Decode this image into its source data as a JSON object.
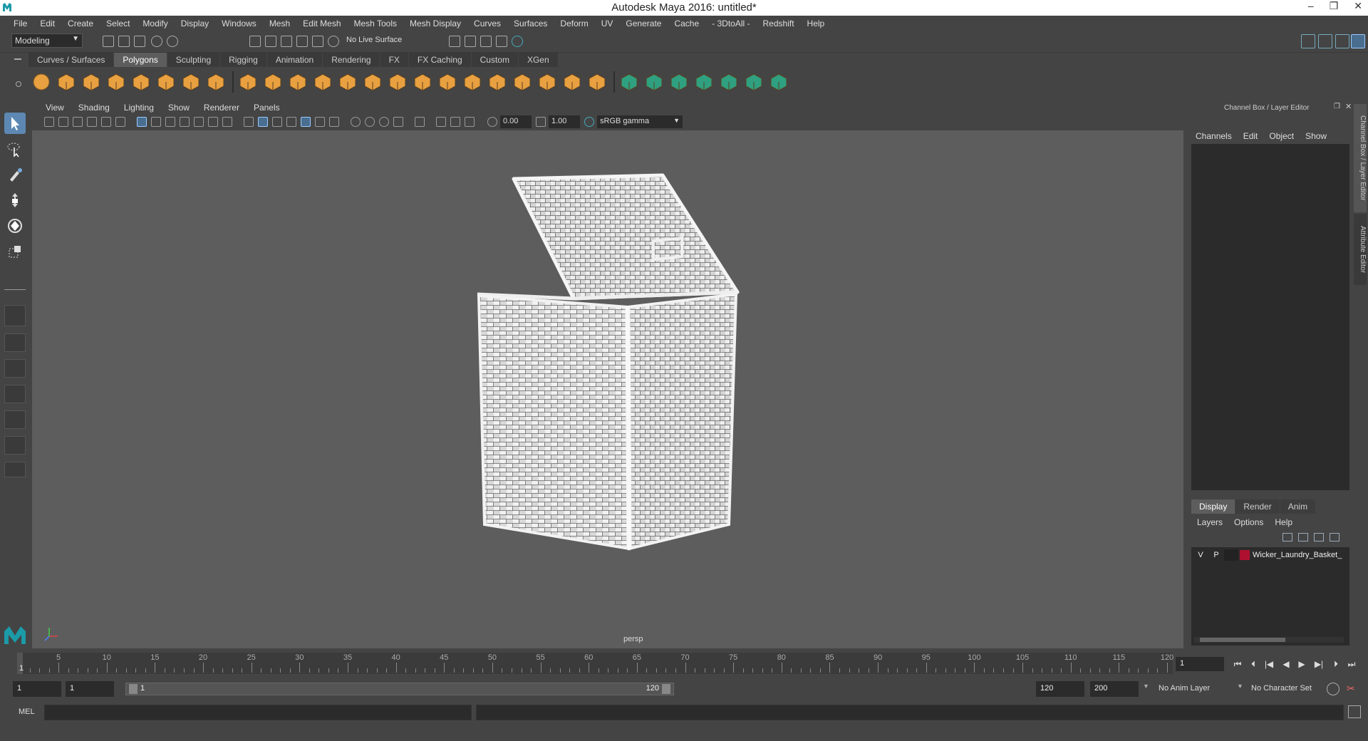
{
  "window": {
    "title": "Autodesk Maya 2016: untitled*"
  },
  "menubar": [
    "File",
    "Edit",
    "Create",
    "Select",
    "Modify",
    "Display",
    "Windows",
    "Mesh",
    "Edit Mesh",
    "Mesh Tools",
    "Mesh Display",
    "Curves",
    "Surfaces",
    "Deform",
    "UV",
    "Generate",
    "Cache",
    "- 3DtoAll -",
    "Redshift",
    "Help"
  ],
  "statusline": {
    "mode": "Modeling",
    "live_surface": "No Live Surface"
  },
  "shelf": {
    "tabs": [
      "Curves / Surfaces",
      "Polygons",
      "Sculpting",
      "Rigging",
      "Animation",
      "Rendering",
      "FX",
      "FX Caching",
      "Custom",
      "XGen"
    ],
    "active_tab": "Polygons"
  },
  "panel": {
    "menus": [
      "View",
      "Shading",
      "Lighting",
      "Show",
      "Renderer",
      "Panels"
    ],
    "exposure": "0.00",
    "gamma": "1.00",
    "color_space": "sRGB gamma",
    "camera_label": "persp"
  },
  "channelbox": {
    "title": "Channel Box / Layer Editor",
    "menus": [
      "Channels",
      "Edit",
      "Object",
      "Show"
    ]
  },
  "layer_editor": {
    "tabs": [
      "Display",
      "Render",
      "Anim"
    ],
    "active_tab": "Display",
    "menus": [
      "Layers",
      "Options",
      "Help"
    ],
    "layers": [
      {
        "v": "V",
        "p": "P",
        "name": "Wicker_Laundry_Basket_",
        "color": "#b01030"
      }
    ]
  },
  "side_tabs": [
    "Channel Box / Layer Editor",
    "Attribute Editor"
  ],
  "timeline": {
    "ticks": [
      5,
      10,
      15,
      20,
      25,
      30,
      35,
      40,
      45,
      50,
      55,
      60,
      65,
      70,
      75,
      80,
      85,
      90,
      95,
      100,
      105,
      110,
      115,
      120
    ],
    "current_frame": "1",
    "current_frame_field": "1"
  },
  "range": {
    "start": "1",
    "playback_start": "1",
    "slider_start": "1",
    "slider_end": "120",
    "playback_end": "120",
    "end": "200",
    "anim_layer": "No Anim Layer",
    "character_set": "No Character Set"
  },
  "cmdline": {
    "label": "MEL"
  },
  "colors": {
    "accent": "#5d88b3",
    "shelf_orange": "#e8a040",
    "shelf_green": "#2fa080",
    "viewport_bg": "#5d5d5d"
  }
}
